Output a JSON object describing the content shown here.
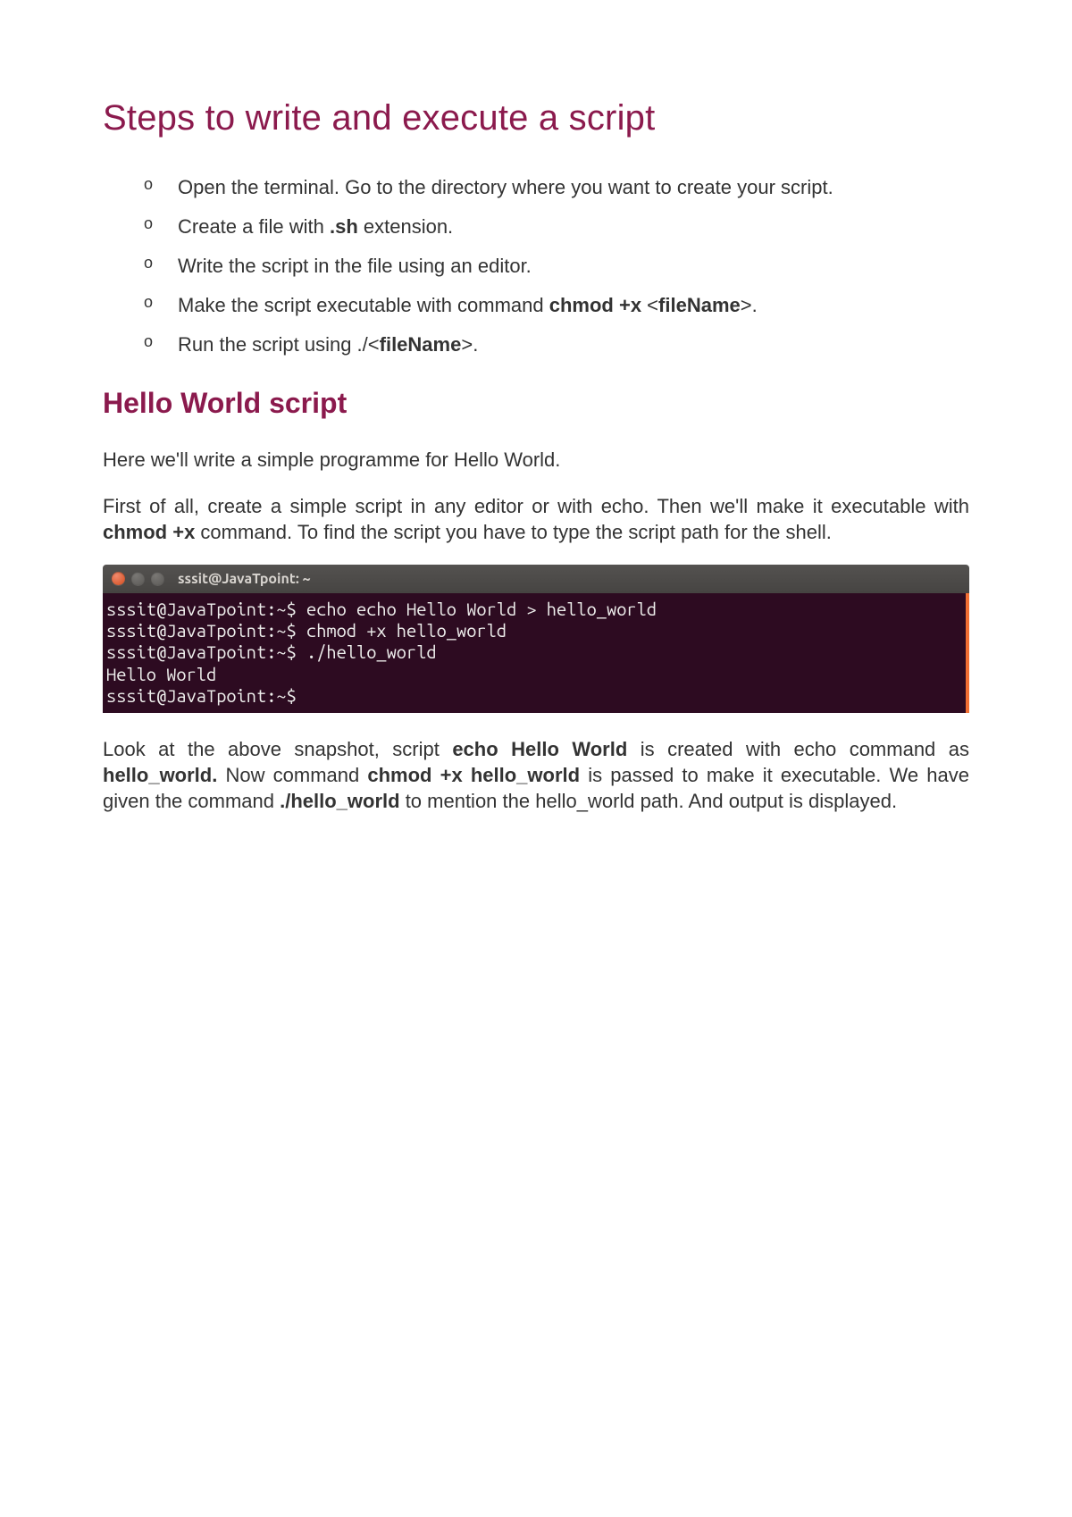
{
  "title": "Steps to write and execute a script",
  "steps": [
    {
      "pre": "Open the terminal. Go to the directory where you want to create your script."
    },
    {
      "pre": "Create a file with ",
      "b1": ".sh",
      "post1": " extension."
    },
    {
      "pre": "Write the script in the file using an editor."
    },
    {
      "pre": "Make the script executable with command ",
      "b1": "chmod +x",
      "mid": " <",
      "b2": "fileName",
      "post2": ">."
    },
    {
      "pre": "Run the script using ./<",
      "b1": "fileName",
      "post1": ">."
    }
  ],
  "subtitle": "Hello World script",
  "intro1": "Here we'll write a simple programme for Hello World.",
  "intro2": {
    "t1": "First of all, create a simple script in any editor or with echo. Then we'll make it executable with ",
    "b1": "chmod +x",
    "t2": " command. To find the script you have to type the script path for the shell."
  },
  "terminal": {
    "title": "sssit@JavaTpoint: ~",
    "lines": [
      "sssit@JavaTpoint:~$ echo echo Hello World > hello_world",
      "sssit@JavaTpoint:~$ chmod +x hello_world",
      "sssit@JavaTpoint:~$ ./hello_world",
      "Hello World",
      "sssit@JavaTpoint:~$"
    ]
  },
  "after": {
    "t1": "Look at the above snapshot, script ",
    "b1": "echo Hello World",
    "t2": " is created with echo command as ",
    "b2": "hello_world.",
    "t3": " Now command ",
    "b3": "chmod +x hello_world",
    "t4": " is passed to make it executable. We have given the command ",
    "b4": "./hello_world",
    "t5": " to mention the hello_world path. And output is displayed."
  }
}
